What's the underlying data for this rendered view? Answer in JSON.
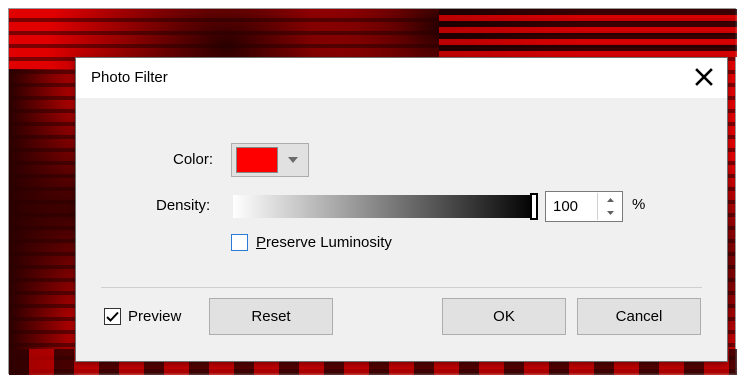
{
  "dialog": {
    "title": "Photo Filter",
    "close_icon": "close-icon"
  },
  "color": {
    "label": "Color:",
    "value": "#ff0000",
    "dropdown_icon": "chevron-down-icon"
  },
  "density": {
    "label": "Density:",
    "value": "100",
    "unit": "%",
    "level": 1.0
  },
  "preserve_luminosity": {
    "label_underlined": "P",
    "label_rest": "reserve Luminosity",
    "checked": false
  },
  "preview": {
    "label": "Preview",
    "checked": true
  },
  "buttons": {
    "reset": "Reset",
    "ok": "OK",
    "cancel": "Cancel"
  },
  "colors": {
    "background_photo": "#e00000",
    "dialog_bg": "#f0f0f0",
    "checkbox_focus": "#2a7ad6"
  }
}
